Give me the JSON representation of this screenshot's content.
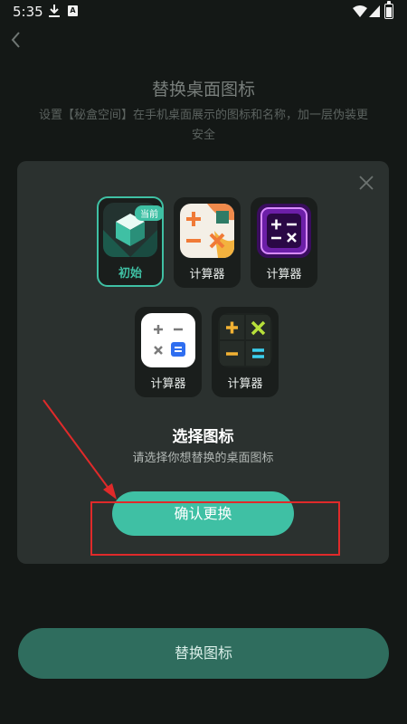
{
  "status_bar": {
    "time": "5:35",
    "notification_badge": "A"
  },
  "header": {
    "title": "替换桌面图标",
    "description": "设置【秘盒空间】在手机桌面展示的图标和名称，加一层伪装更安全"
  },
  "dialog": {
    "icons_row1": [
      {
        "label": "初始",
        "badge": "当前",
        "selected": true
      },
      {
        "label": "计算器",
        "selected": false
      },
      {
        "label": "计算器",
        "selected": false
      }
    ],
    "icons_row2": [
      {
        "label": "计算器",
        "selected": false
      },
      {
        "label": "计算器",
        "selected": false
      }
    ],
    "title": "选择图标",
    "subtitle": "请选择你想替换的桌面图标",
    "confirm_label": "确认更换"
  },
  "footer": {
    "replace_label": "替换图标"
  },
  "colors": {
    "accent": "#3fc0a4",
    "annotation_red": "#e02a2a",
    "background": "#141816",
    "dialog_background": "#2b312f"
  }
}
